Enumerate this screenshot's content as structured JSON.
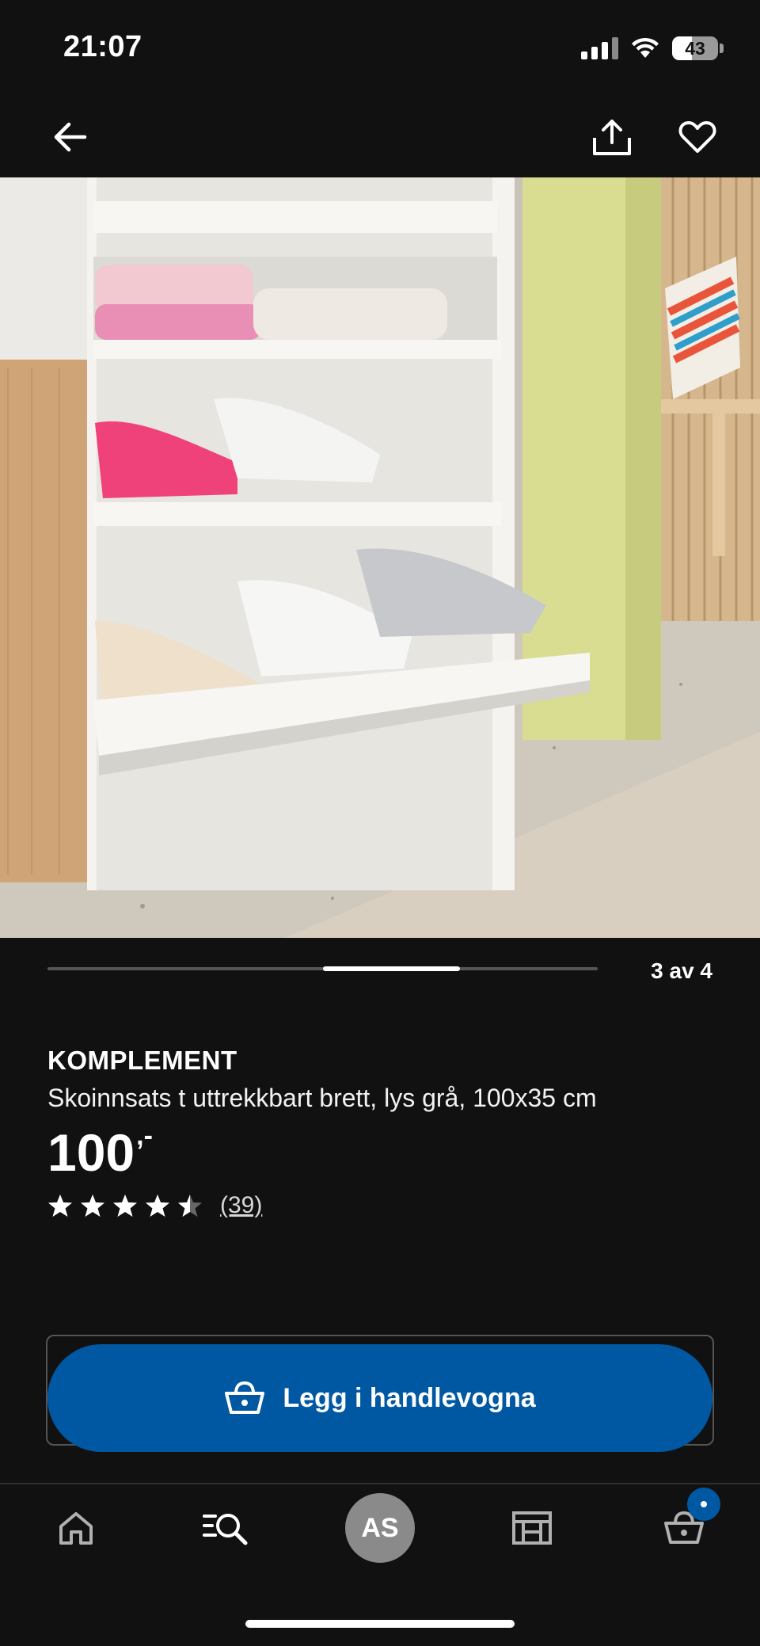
{
  "status_bar": {
    "time": "21:07",
    "battery": "43",
    "battery_level_percent": 43,
    "icons": [
      "signal-icon",
      "wifi-icon",
      "battery-icon"
    ]
  },
  "top_nav": {
    "icons": [
      "back-arrow-icon",
      "share-icon",
      "heart-icon"
    ]
  },
  "carousel": {
    "current": 3,
    "total": 4,
    "counter": "3 av 4"
  },
  "product": {
    "brand": "KOMPLEMENT",
    "description": "Skoinnsats t uttrekkbart brett, lys grå, 100x35 cm",
    "price": "100",
    "price_suffix": ",-",
    "rating": 4.5,
    "rating_max": 5,
    "review_count": "(39)"
  },
  "cart_button": {
    "label": "Legg i handlevogna",
    "icon": "basket-icon"
  },
  "tab_bar": {
    "items": [
      "home-icon",
      "search-list-icon",
      "avatar",
      "store-icon",
      "cart-icon"
    ],
    "avatar_initials": "AS",
    "cart_badge_visible": true
  },
  "colors": {
    "background": "#111111",
    "accent": "#0058a3",
    "text": "#ffffff",
    "avatar": "#8a8a8a"
  }
}
